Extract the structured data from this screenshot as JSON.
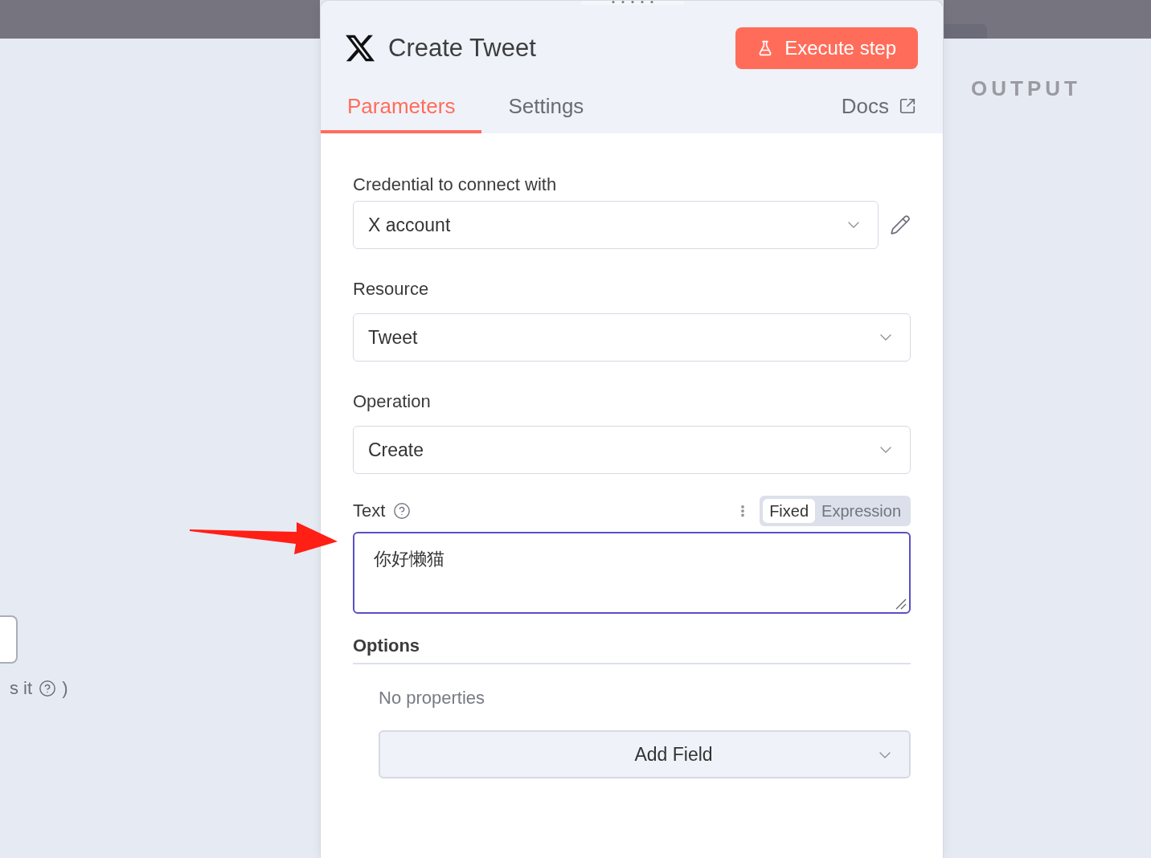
{
  "node": {
    "title": "Create Tweet",
    "execute_button": "Execute step"
  },
  "tabs": [
    {
      "label": "Parameters",
      "selected": true
    },
    {
      "label": "Settings",
      "selected": false
    }
  ],
  "docs_link": "Docs",
  "fields": [
    {
      "kind": "select",
      "label": "Credential to connect with",
      "value": "X account",
      "editable": true
    },
    {
      "kind": "select",
      "label": "Resource",
      "value": "Tweet",
      "editable": false
    },
    {
      "kind": "select",
      "label": "Operation",
      "value": "Create",
      "editable": false
    },
    {
      "kind": "textarea",
      "label": "Text",
      "value": "你好懒猫",
      "focused": true,
      "has_help": true,
      "mode_toggle": [
        {
          "label": "Fixed",
          "selected": true
        },
        {
          "label": "Expression",
          "selected": false
        }
      ]
    }
  ],
  "options": {
    "title": "Options",
    "empty_text": "No properties",
    "add_button": "Add Field"
  },
  "input_panel": {
    "fragment_text": "s it",
    "closing_paren": ")"
  },
  "output_panel": {
    "title": "OUTPUT"
  }
}
